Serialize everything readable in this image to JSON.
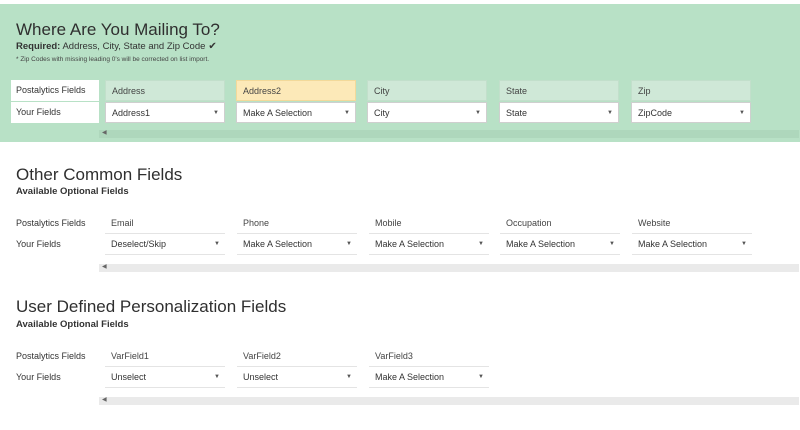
{
  "mailing": {
    "title": "Where Are You Mailing To?",
    "required_label": "Required:",
    "required_text": " Address, City, State and Zip Code",
    "check_glyph": "✔",
    "note": "* Zip Codes with missing leading 0's will be corrected on list import.",
    "postalytics_label": "Postalytics Fields",
    "your_fields_label": "Your Fields",
    "columns": [
      {
        "head": "Address",
        "value": "Address1"
      },
      {
        "head": "Address2",
        "value": "Make A Selection"
      },
      {
        "head": "City",
        "value": "City"
      },
      {
        "head": "State",
        "value": "State"
      },
      {
        "head": "Zip",
        "value": "ZipCode"
      }
    ]
  },
  "common": {
    "title": "Other Common Fields",
    "subtitle": "Available Optional Fields",
    "postalytics_label": "Postalytics Fields",
    "your_fields_label": "Your Fields",
    "columns": [
      {
        "head": "Email",
        "value": "Deselect/Skip"
      },
      {
        "head": "Phone",
        "value": "Make A Selection"
      },
      {
        "head": "Mobile",
        "value": "Make A Selection"
      },
      {
        "head": "Occupation",
        "value": "Make A Selection"
      },
      {
        "head": "Website",
        "value": "Make A Selection"
      }
    ]
  },
  "user_defined": {
    "title": "User Defined Personalization Fields",
    "subtitle": "Available Optional Fields",
    "postalytics_label": "Postalytics Fields",
    "your_fields_label": "Your Fields",
    "columns": [
      {
        "head": "VarField1",
        "value": "Unselect"
      },
      {
        "head": "VarField2",
        "value": "Unselect"
      },
      {
        "head": "VarField3",
        "value": "Make A Selection"
      }
    ]
  },
  "icons": {
    "dropdown_arrow": "▼",
    "scroll_left": "◀"
  },
  "colors": {
    "mailing_bg": "#b8e1c6",
    "highlight_header": "#fce9b8"
  }
}
